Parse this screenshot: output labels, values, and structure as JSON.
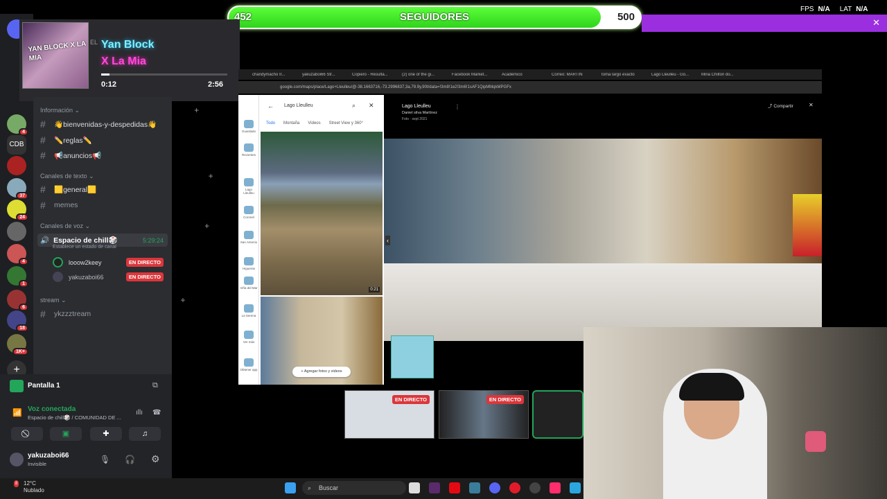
{
  "followers": {
    "current": "452",
    "label": "SEGUIDORES",
    "goal": "500",
    "progress": 0.904
  },
  "stats": {
    "fps_label": "FPS",
    "fps_value": "N/A",
    "lat_label": "LAT",
    "lat_value": "N/A"
  },
  "music": {
    "cover_text": "YAN BLOCK X LA MIA",
    "artist": "Yan Block",
    "title": "X La Mia",
    "elapsed": "0:12",
    "duration": "2:56",
    "progress": 0.068,
    "ghost_text": "EL"
  },
  "servers": [
    {
      "badge": "4"
    },
    {
      "badge": ""
    },
    {
      "label": "CDB"
    },
    {
      "badge": ""
    },
    {
      "badge": "37"
    },
    {
      "badge": "24"
    },
    {
      "badge": ""
    },
    {
      "badge": "4"
    },
    {
      "badge": "1"
    },
    {
      "badge": "6"
    },
    {
      "badge": "18"
    },
    {
      "badge": "1K+"
    }
  ],
  "channels": {
    "informacion": "Información",
    "bienvenidas": "👋bienvenidas-y-despedidas👋",
    "reglas": "✏️reglas✏️",
    "anuncios": "📢anuncios📢",
    "texto": "Canales de texto",
    "general": "🟨general🟨",
    "memes": "memes",
    "voz": "Canales de voz",
    "chill": "Espacio de chill🎲",
    "chill_time": "5:29:24",
    "chill_status": "Establece un estado de canal",
    "user1": "looow2keey",
    "user2": "yakuzaboi66",
    "live": "EN DIRECTO",
    "stream": "stream",
    "ykzz": "ykzzztream"
  },
  "panel": {
    "screen": "Pantalla 1",
    "voice": "Voz conectada",
    "voice_sub": "Espacio de chill🎲 / COMUNIDAD DE ...",
    "user": "yakuzaboi66",
    "status": "Invisible"
  },
  "browser": {
    "tabs": [
      "chandymacho Ir...",
      "yakuzaboi66 Str...",
      "Copiero - Resulta...",
      "(2) one of the gi...",
      "Facebook Market...",
      "Académico",
      "Correo: MARTIN",
      "toma largo exacto",
      "Lago Lleulleu - Go...",
      "Mina Chilton do..."
    ],
    "url": "google.com/maps/place/Lago+Lleulleu/@-38.1663716,-73.2996837,3a,79.9y,90t/data=!3m8!1e2!3m6!1sAF1QipMMqkMPGFx",
    "place": "Lago Lleulleu",
    "map_tabs": [
      "Todo",
      "Montaña",
      "Videos",
      "Street View y 360°"
    ],
    "rail": [
      "Guardado",
      "Recientes",
      "Lago Lleulleu",
      "Coronel",
      "San Antonio",
      "Higueras",
      "Viña del Mar",
      "La Serena",
      "Ver más",
      "Obtener app"
    ],
    "add_photos": "Agregar fotos y videos",
    "video_time": "0:21",
    "photo_title": "Lago Lleulleu",
    "photo_author": "Daniel silva Martínez",
    "photo_date": "Foto · sept 2021",
    "share": "Compartir"
  },
  "thumbs": [
    "EN DIRECTO",
    "EN DIRECTO"
  ],
  "weather": {
    "temp": "12°C",
    "desc": "Nublado",
    "badge": "8"
  },
  "taskbar": {
    "search": "Buscar"
  },
  "colors": {
    "accent_green": "#2fd41c",
    "purple": "#9b2fe0",
    "discord_live": "#da373c"
  }
}
